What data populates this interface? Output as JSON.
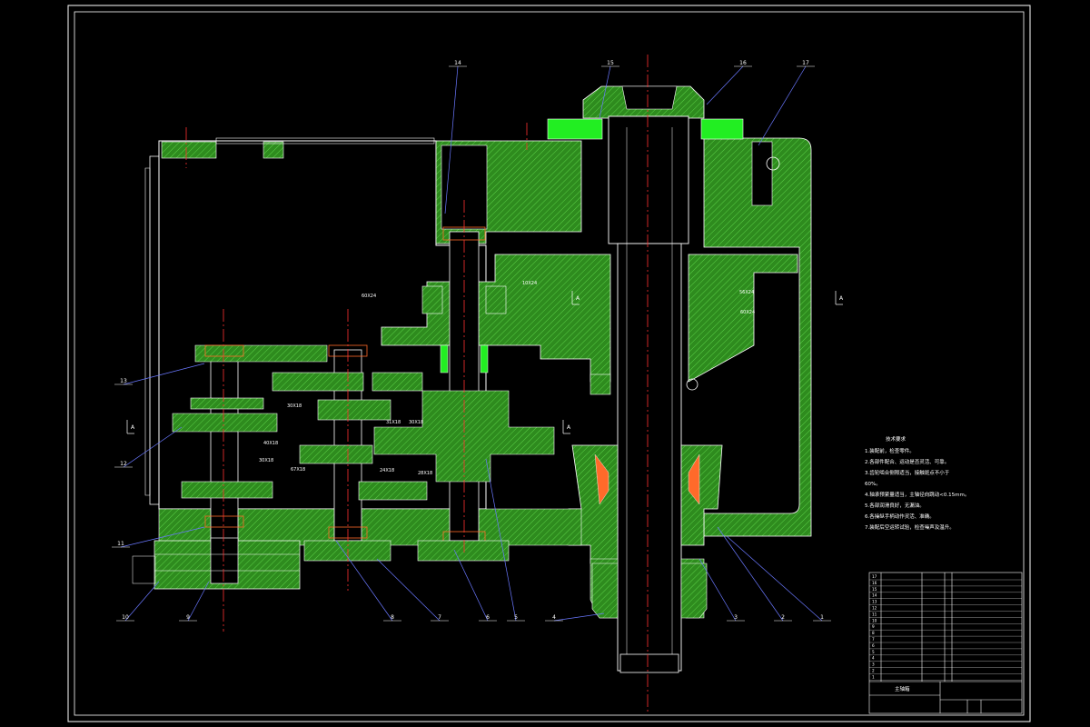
{
  "colors": {
    "background": "#000000",
    "outline": "#ffffff",
    "part_fill": "#2e8b1e",
    "hatch": "#3cb829",
    "highlight": "#22ee22",
    "centerline": "#ff3030",
    "leader": "#6a78ff",
    "bearing": "#ff6a2a"
  },
  "balloons": [
    "1",
    "2",
    "3",
    "4",
    "5",
    "6",
    "7",
    "8",
    "9",
    "10",
    "11",
    "12",
    "13",
    "14",
    "15",
    "16",
    "17"
  ],
  "section_marks": {
    "a": "A"
  },
  "gear_labels": [
    "10X24",
    "56X24",
    "60X24",
    "60X24",
    "30X18",
    "31X18",
    "40X18",
    "30X18",
    "67X18",
    "24X18",
    "28X18",
    "30X18"
  ],
  "shaft_labels": [
    "spline-top",
    "spline-mid",
    "spline-lower",
    "spline-bottom"
  ],
  "notes": {
    "title": "技术要求",
    "lines": [
      "1.装配前，检查零件。",
      "2.各部件配合、运动是否灵活、可靠。",
      "3.齿轮啮合侧隙适当，接触斑点不小于",
      "  60%。",
      "4.轴承预紧量适当，主轴径向跳动<0.15mm。",
      "5.各部润滑良好，无漏油。",
      "6.各操纵手柄动作灵活、准确。",
      "7.装配后空运转试验，检查噪声及温升。"
    ]
  },
  "title_block": {
    "drawing_title": "主轴箱",
    "rows": [
      "17",
      "16",
      "15",
      "14",
      "13",
      "12",
      "11",
      "10",
      "9",
      "8",
      "7",
      "6",
      "5",
      "4",
      "3",
      "2",
      "1"
    ]
  }
}
